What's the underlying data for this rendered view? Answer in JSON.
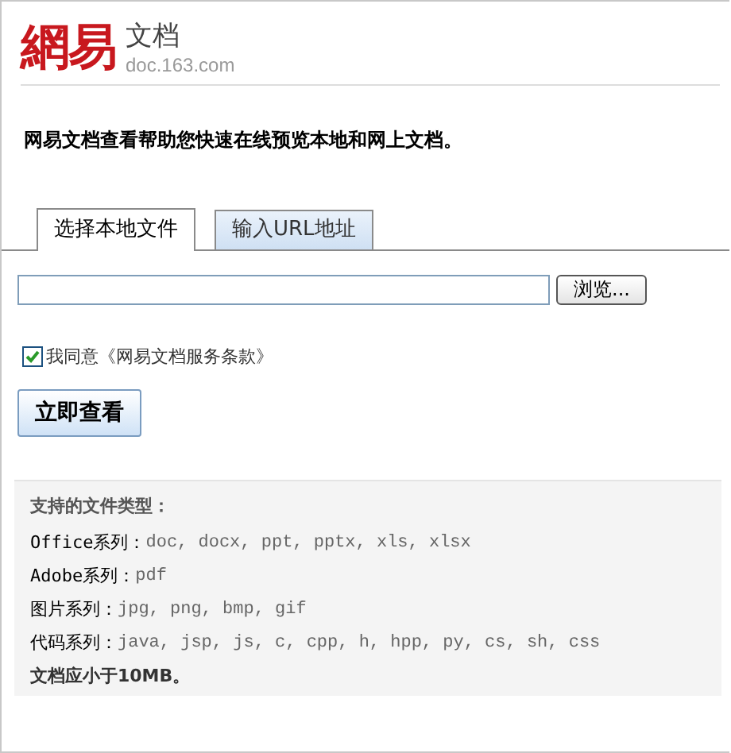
{
  "header": {
    "logo": "網易",
    "product": "文档",
    "domain": "doc.163.com"
  },
  "intro": "网易文档查看帮助您快速在线预览本地和网上文档。",
  "tabs": [
    {
      "label": "选择本地文件",
      "selected": true
    },
    {
      "label": "输入URL地址",
      "selected": false
    }
  ],
  "file_field": {
    "browse_button": "浏览..."
  },
  "agree": {
    "checked": true,
    "label": "我同意《网易文档服务条款》"
  },
  "submit_button": "立即查看",
  "info": {
    "title": "支持的文件类型：",
    "rows": [
      {
        "label": "Office系列：",
        "value": "doc, docx, ppt, pptx, xls, xlsx"
      },
      {
        "label": "Adobe系列：",
        "value": "pdf"
      },
      {
        "label": "图片系列：",
        "value": "jpg, png, bmp, gif"
      },
      {
        "label": "代码系列：",
        "value": "java, jsp, js, c, cpp, h, hpp, py, cs, sh, css"
      }
    ],
    "note": "文档应小于10MB。"
  }
}
